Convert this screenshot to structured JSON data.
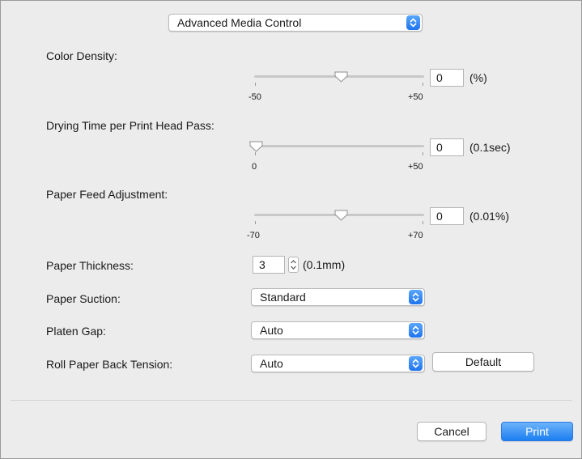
{
  "dialog": {
    "section_popup": {
      "value": "Advanced Media Control"
    }
  },
  "color_density": {
    "label": "Color Density:",
    "min_label": "-50",
    "max_label": "+50",
    "value": "0",
    "unit": "(%)",
    "slider_fraction": 0.5
  },
  "drying_time": {
    "label": "Drying Time per Print Head Pass:",
    "min_label": "0",
    "max_label": "+50",
    "value": "0",
    "unit": "(0.1sec)",
    "slider_fraction": 0.0
  },
  "paper_feed": {
    "label": "Paper Feed Adjustment:",
    "min_label": "-70",
    "max_label": "+70",
    "value": "0",
    "unit": "(0.01%)",
    "slider_fraction": 0.5
  },
  "paper_thickness": {
    "label": "Paper Thickness:",
    "value": "3",
    "unit": "(0.1mm)"
  },
  "paper_suction": {
    "label": "Paper Suction:",
    "value": "Standard"
  },
  "platen_gap": {
    "label": "Platen Gap:",
    "value": "Auto"
  },
  "roll_paper_tension": {
    "label": "Roll Paper Back Tension:",
    "value": "Auto",
    "default_button": "Default"
  },
  "footer": {
    "cancel": "Cancel",
    "print": "Print"
  },
  "colors": {
    "accent": "#1f74ee",
    "background": "#ececec"
  }
}
